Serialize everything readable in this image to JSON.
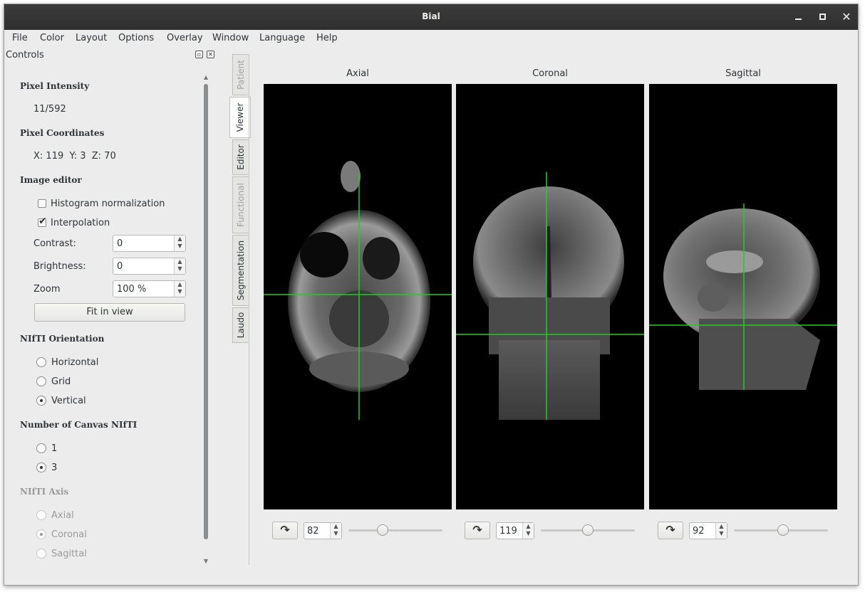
{
  "window": {
    "title": "Bial"
  },
  "menu": [
    "File",
    "Color",
    "Layout",
    "Options",
    "Overlay",
    "Window",
    "Language",
    "Help"
  ],
  "controls": {
    "header": "Controls",
    "pixel_intensity": {
      "label": "Pixel Intensity",
      "value": "11/592"
    },
    "pixel_coordinates": {
      "label": "Pixel Coordinates",
      "value": "X: 119  Y: 3  Z: 70"
    },
    "image_editor": {
      "label": "Image editor",
      "histogram_normalization": {
        "label": "Histogram normalization",
        "checked": false
      },
      "interpolation": {
        "label": "Interpolation",
        "checked": true
      },
      "contrast": {
        "label": "Contrast:",
        "value": "0"
      },
      "brightness": {
        "label": "Brightness:",
        "value": "0"
      },
      "zoom": {
        "label": "Zoom",
        "value": "100 %"
      },
      "fit_button": "Fit in view"
    },
    "nifti_orientation": {
      "label": "NIfTI Orientation",
      "options": [
        "Horizontal",
        "Grid",
        "Vertical"
      ],
      "selected": "Vertical"
    },
    "canvas_count": {
      "label": "Number of Canvas NIfTI",
      "options": [
        "1",
        "3"
      ],
      "selected": "3"
    },
    "nifti_axis": {
      "label": "NIfTI Axis",
      "options": [
        "Axial",
        "Coronal",
        "Sagittal"
      ],
      "selected": "Coronal",
      "enabled": false
    }
  },
  "tabs": [
    {
      "label": "Patient",
      "enabled": false,
      "active": false
    },
    {
      "label": "Viewer",
      "enabled": true,
      "active": true
    },
    {
      "label": "Editor",
      "enabled": true,
      "active": false
    },
    {
      "label": "Functional",
      "enabled": false,
      "active": false
    },
    {
      "label": "Segmentation",
      "enabled": true,
      "active": false
    },
    {
      "label": "Laudo",
      "enabled": true,
      "active": false
    }
  ],
  "views": [
    {
      "label": "Axial",
      "slice": "82",
      "slider_fraction": 0.36
    },
    {
      "label": "Coronal",
      "slice": "119",
      "slider_fraction": 0.5
    },
    {
      "label": "Sagittal",
      "slice": "92",
      "slider_fraction": 0.52
    }
  ],
  "icons": {
    "rotate": "rotate-icon",
    "crosshair_color": "#22cc22"
  }
}
